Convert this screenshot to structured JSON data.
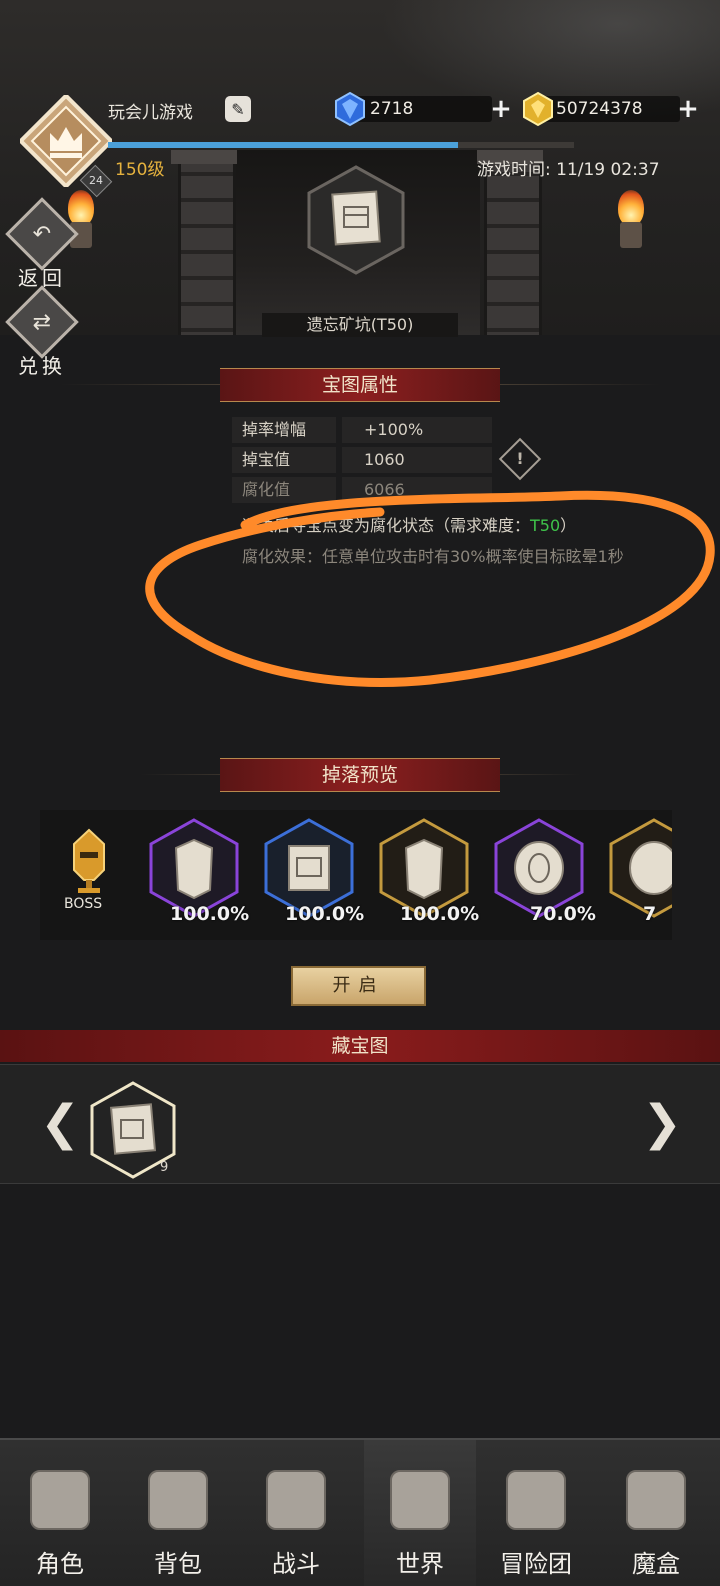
{
  "header": {
    "nickname": "玩会儿游戏",
    "level_text": "150级",
    "level_badge": "24",
    "xp_progress": 0.75,
    "diamonds": "2718",
    "gold": "50724378",
    "game_time": "游戏时间: 11/19 02:37"
  },
  "side_buttons": {
    "back_label": "返回",
    "exchange_label": "兑换"
  },
  "location": {
    "name": "遗忘矿坑(T50)"
  },
  "attributes": {
    "title": "宝图属性",
    "rows": [
      {
        "label": "掉率增幅",
        "value": "+100%"
      },
      {
        "label": "掉宝值",
        "value": "1060"
      },
      {
        "label": "腐化值",
        "value": "6066"
      }
    ],
    "desc_prefix": "通关后寻宝点变为腐化状态（需求难度：",
    "desc_tier": "T50",
    "desc_suffix": "）",
    "effect": "腐化效果：任意单位攻击时有30%概率使目标眩晕1秒"
  },
  "drops": {
    "title": "掉落预览",
    "boss_label": "BOSS",
    "items": [
      {
        "name": "armor-icon",
        "rarity": "purple",
        "pct": "100.0%"
      },
      {
        "name": "treasure-map-icon",
        "rarity": "blue",
        "pct": "100.0%"
      },
      {
        "name": "armor-icon",
        "rarity": "gold",
        "pct": "100.0%"
      },
      {
        "name": "shield-icon",
        "rarity": "purple",
        "pct": "70.0%"
      },
      {
        "name": "shield-icon",
        "rarity": "gold",
        "pct": "7"
      }
    ]
  },
  "open_button": "开启",
  "treasure_maps": {
    "title": "藏宝图",
    "count": "9"
  },
  "nav": [
    {
      "label": "角色"
    },
    {
      "label": "背包"
    },
    {
      "label": "战斗"
    },
    {
      "label": "世界"
    },
    {
      "label": "冒险团"
    },
    {
      "label": "魔盒"
    }
  ],
  "colors": {
    "banner_red": "#8c1f1f",
    "accent_gold": "#e5b23e",
    "tier_green": "#3fc34a",
    "annotation_orange": "#ff8a2a"
  }
}
